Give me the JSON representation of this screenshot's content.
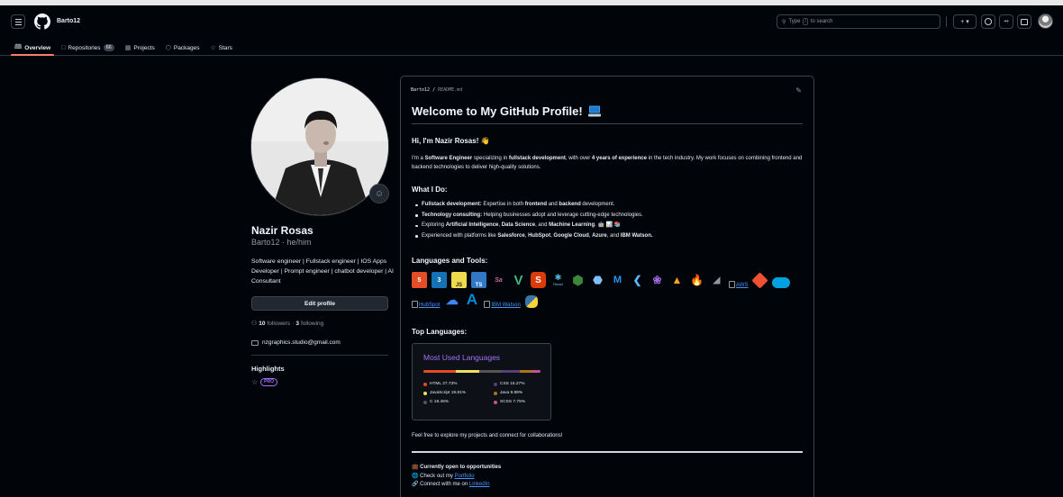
{
  "header": {
    "owner": "Barto12",
    "search_placeholder": "Type / to search",
    "search_pre": "Type",
    "search_key": "/",
    "search_post": "to search",
    "plus_label": "+ ▾"
  },
  "tabs": [
    {
      "label": "Overview",
      "icon": "book-icon"
    },
    {
      "label": "Repositories",
      "icon": "repo-icon",
      "count": "66"
    },
    {
      "label": "Projects",
      "icon": "table-icon"
    },
    {
      "label": "Packages",
      "icon": "package-icon"
    },
    {
      "label": "Stars",
      "icon": "star-icon"
    }
  ],
  "profile": {
    "name": "Nazir Rosas",
    "login_line": "Barto12 · he/him",
    "bio": "Software engineer | Fullstack engineer | IOS Apps Developer | Prompt engineer | chatbot developer | AI Consultant",
    "edit_label": "Edit profile",
    "followers": "10",
    "followers_label": "followers",
    "following": "3",
    "following_label": "following",
    "email": "nzgraphics.studio@gmail.com",
    "highlights_title": "Highlights",
    "pro_badge": "PRO"
  },
  "readme": {
    "path_owner": "Barto12",
    "path_file": "README.md",
    "title": "Welcome to My GitHub Profile!",
    "greeting": "Hi, I'm Nazir Rosas! 👋",
    "intro_a": "I'm a ",
    "intro_b": "Software Engineer",
    "intro_c": " specializing in ",
    "intro_d": "fullstack development",
    "intro_e": ", with over ",
    "intro_f": "4 years of experience",
    "intro_g": " in the tech industry. My work focuses on combining frontend and backend technologies to deliver high-quality solutions.",
    "what_title": "What I Do:",
    "do_1a": "Fullstack development:",
    "do_1b": " Expertise in both ",
    "do_1c": "frontend",
    "do_1d": " and ",
    "do_1e": "backend",
    "do_1f": " development.",
    "do_2a": "Technology consulting:",
    "do_2b": " Helping businesses adopt and leverage cutting-edge technologies.",
    "do_3a": "Exploring ",
    "do_3b": "Artificial Intelligence",
    "do_3c": ", ",
    "do_3d": "Data Science",
    "do_3e": ", and ",
    "do_3f": "Machine Learning",
    "do_3g": ". 🤖 📊 📚",
    "do_4a": "Experienced with platforms like ",
    "do_4b": "Salesforce",
    "do_4c": ", ",
    "do_4d": "HubSpot",
    "do_4e": ", ",
    "do_4f": "Google Cloud",
    "do_4g": ", ",
    "do_4h": "Azure",
    "do_4i": ", and ",
    "do_4j": "IBM Watson.",
    "tools_title": "Languages and Tools:",
    "tool_aws": "AWS",
    "tool_hubspot": "HubSpot",
    "tool_ibm": "IBM Watson",
    "react_label": "React",
    "top_title": "Top Languages:",
    "langs_card_title": "Most Used Languages",
    "langs": [
      {
        "name": "HTML",
        "pct": "27.73%",
        "value": 27.73,
        "color": "#e34c26"
      },
      {
        "name": "CSS",
        "pct": "15.27%",
        "value": 15.27,
        "color": "#563d7c"
      },
      {
        "name": "JavaScript",
        "pct": "19.81%",
        "value": 19.81,
        "color": "#f1e05a"
      },
      {
        "name": "Java",
        "pct": "9.89%",
        "value": 9.89,
        "color": "#b07219"
      },
      {
        "name": "C",
        "pct": "19.45%",
        "value": 19.45,
        "color": "#555555"
      },
      {
        "name": "SCSS",
        "pct": "7.75%",
        "value": 7.75,
        "color": "#c6538c"
      }
    ],
    "explore_text": "Feel free to explore my projects and connect for collaborations!",
    "open_text": "Currently open to opportunities",
    "portfolio_pre": "Check out my ",
    "portfolio_link": "Portfolio",
    "linkedin_pre": "Connect with me on ",
    "linkedin_link": "LinkedIn"
  },
  "colors": {
    "accent_tab": "#f78166",
    "link": "#4493f8",
    "pro": "#a371f7",
    "background": "#010409"
  }
}
